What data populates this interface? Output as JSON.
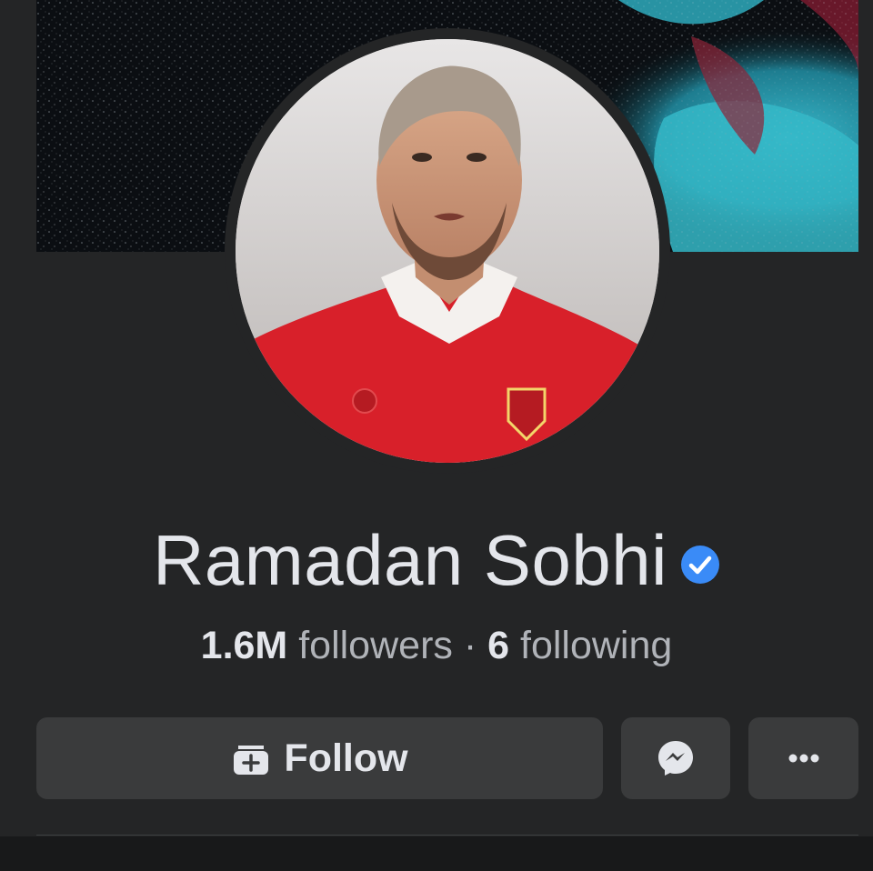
{
  "profile": {
    "name": "Ramadan Sobhi",
    "verified": true,
    "followers_count": "1.6M",
    "followers_label": "followers",
    "separator": "·",
    "following_count": "6",
    "following_label": "following"
  },
  "actions": {
    "follow_label": "Follow",
    "follow_icon": "follow-add-icon",
    "messenger_icon": "messenger-icon",
    "more_icon": "more-options-icon"
  },
  "colors": {
    "background": "#242526",
    "button_bg": "#3a3b3c",
    "text_primary": "#e4e6eb",
    "text_secondary": "#b0b3b8",
    "verified_blue": "#3a8bf7"
  }
}
